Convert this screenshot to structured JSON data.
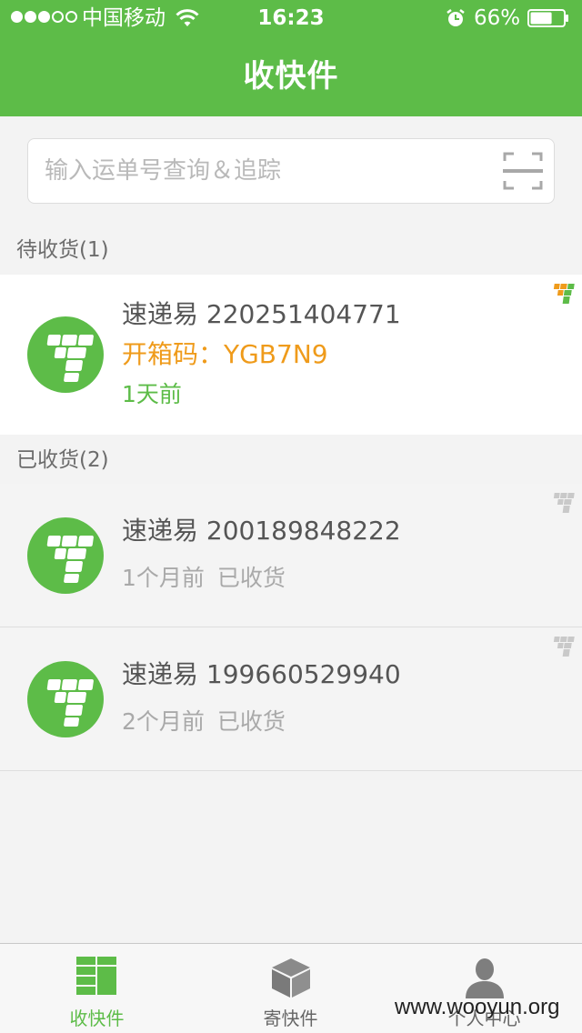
{
  "status_bar": {
    "carrier": "中国移动",
    "time": "16:23",
    "battery": "66%",
    "battery_level": 0.66,
    "signal_bars": 3,
    "signal_total": 5
  },
  "header": {
    "title": "收快件"
  },
  "search": {
    "placeholder": "输入运单号查询＆追踪",
    "value": ""
  },
  "sections": {
    "pending_title": "待收货(1)",
    "received_title": "已收货(2)"
  },
  "pending": [
    {
      "tracking": "速递易 220251404771",
      "code": "开箱码：YGB7N9",
      "time": "1天前"
    }
  ],
  "received": [
    {
      "tracking": "速递易 200189848222",
      "time": "1个月前",
      "status": "已收货"
    },
    {
      "tracking": "速递易 199660529940",
      "time": "2个月前",
      "status": "已收货"
    }
  ],
  "tab_bar": {
    "tabs": [
      {
        "label": "收快件",
        "icon": "grid-list-icon",
        "active": true
      },
      {
        "label": "寄快件",
        "icon": "box-icon",
        "active": false
      },
      {
        "label": "个人中心",
        "icon": "user-icon",
        "active": false
      }
    ]
  },
  "watermark": "www.wooyun.org",
  "colors": {
    "brand_green": "#5dbc48",
    "code_orange": "#ef9b1b",
    "muted_grey": "#a9a9a9"
  }
}
